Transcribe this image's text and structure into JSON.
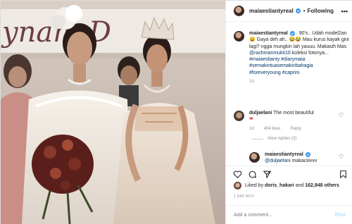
{
  "post": {
    "username": "maiaestiantyreal",
    "follow_state": "Following",
    "photo_text": "ynam D"
  },
  "caption": {
    "username": "maiaestiantyreal",
    "text_before": " . 90's.. Udah model2an ",
    "text_mid": " Gaya deh ah.. ",
    "text_after": " Mau kurus kayak gini lagi? ngga mungkin lah yauuu. Makasih Mas ",
    "mention": "@rachmanmukti16",
    "text_end": " koleksi fotonya...",
    "hashtags": [
      "#maiaestianty",
      "#diarymaia",
      "#semakintuasemakinbahagia",
      "#foreveryoung",
      "#caprini"
    ],
    "time": "1d"
  },
  "comments": [
    {
      "username": "duljaelani",
      "text": "The most beautiful",
      "time": "1d",
      "likes": "404 likes",
      "reply": "Reply"
    }
  ],
  "replies": {
    "label": "View replies (3)",
    "items": [
      {
        "username": "maiaestiantyreal",
        "mention": "@duljaelani",
        "text": " makaciiivvv"
      }
    ]
  },
  "likes": {
    "prefix": "Liked by ",
    "user": "doris_hakari",
    "middle": " and ",
    "count": "162,948 others"
  },
  "timestamp": "1 DAY AGO",
  "add_comment": {
    "placeholder": "Add a comment...",
    "post_label": "Post"
  },
  "colors": {
    "link": "#00376b",
    "verified": "#3897f0",
    "heart": "#ed4956",
    "post_disabled": "#b2dffc"
  },
  "icons": [
    "verified-badge-icon",
    "more-options-icon",
    "heart-icon",
    "comment-icon",
    "share-icon",
    "bookmark-icon"
  ]
}
